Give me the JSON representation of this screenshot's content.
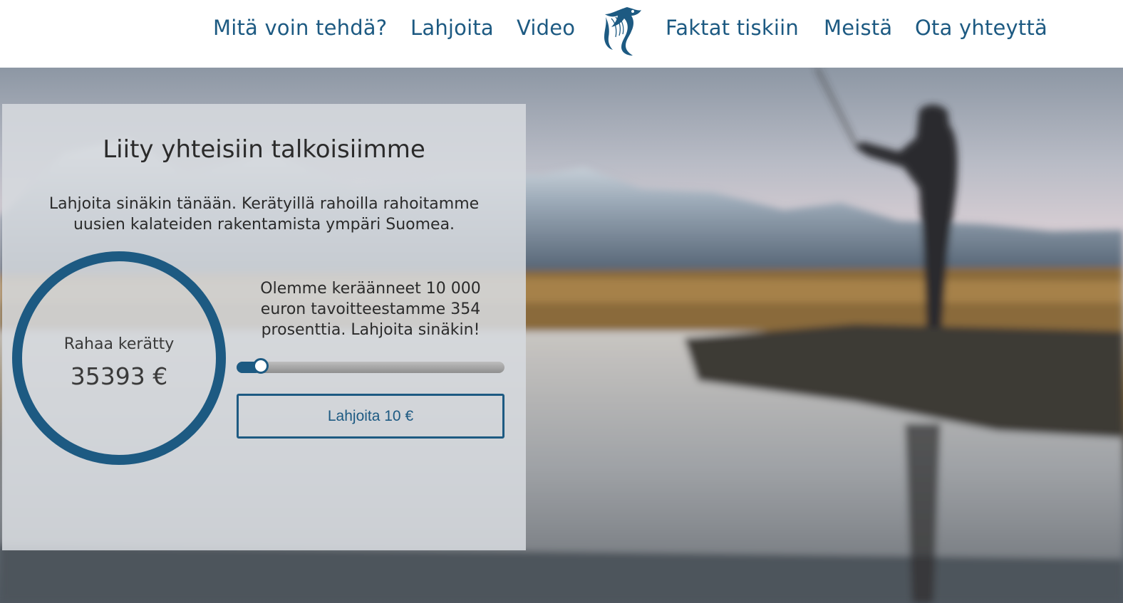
{
  "nav": {
    "items": [
      "Mitä voin tehdä?",
      "Lahjoita",
      "Video",
      "Faktat tiskiin",
      "Meistä",
      "Ota yhteyttä"
    ],
    "logo_icon": "fish-logo-icon"
  },
  "hero": {
    "title": "Liity yhteisiin talkoisiimme",
    "intro": "Lahjoita sinäkin tänään. Kerätyillä rahoilla rahoitamme uusien kalateiden rakentamista ympäri Suomea.",
    "raised_label": "Rahaa kerätty",
    "raised_value": "35393 €",
    "status_text": "Olemme keräänneet 10 000 euron tavoitteestamme 354 prosenttia. Lahjoita sinäkin!",
    "slider_value_fraction": 0.09,
    "donate_button": "Lahjoita 10 €"
  },
  "colors": {
    "accent": "#1d5a82",
    "text": "#2b2b2b"
  }
}
